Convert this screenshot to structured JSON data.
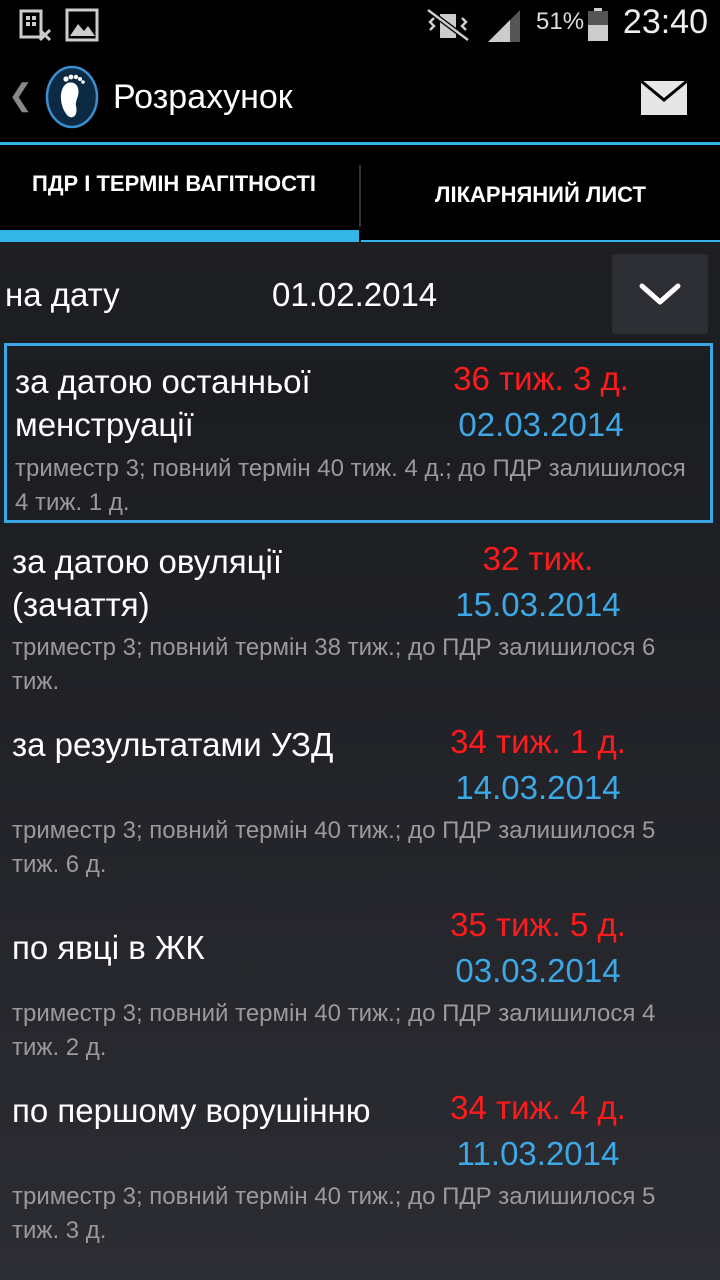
{
  "status_bar": {
    "battery": "51%",
    "time": "23:40"
  },
  "action_bar": {
    "title": "Розрахунок"
  },
  "tabs": [
    {
      "label": "ПДР І ТЕРМІН ВАГІТНОСТІ",
      "selected": true
    },
    {
      "label": "ЛІКАРНЯНИЙ ЛИСТ",
      "selected": false
    }
  ],
  "date_row": {
    "label": "на дату",
    "value": "01.02.2014"
  },
  "items": [
    {
      "title": "за датою останньої менструації",
      "weeks": "36 тиж. 3 д.",
      "date": "02.03.2014",
      "info": "триместр 3; повний термін 40 тиж. 4 д.; до ПДР залишилося 4 тиж. 1 д.",
      "selected": true
    },
    {
      "title": "за датою овуляції (зачаття)",
      "weeks": "32 тиж.",
      "date": "15.03.2014",
      "info": "триместр 3; повний термін 38 тиж.; до ПДР залишилося 6 тиж.",
      "selected": false
    },
    {
      "title": "за результатами УЗД",
      "weeks": "34 тиж. 1 д.",
      "date": "14.03.2014",
      "info": "триместр 3; повний термін 40 тиж.; до ПДР залишилося 5 тиж. 6 д.",
      "selected": false
    },
    {
      "title": "по явці в ЖК",
      "weeks": "35 тиж. 5 д.",
      "date": "03.03.2014",
      "info": "триместр 3; повний термін 40 тиж.; до ПДР залишилося 4 тиж. 2 д.",
      "selected": false
    },
    {
      "title": "по першому ворушінню",
      "weeks": "34 тиж. 4 д.",
      "date": "11.03.2014",
      "info": "триместр 3; повний термін 40 тиж.; до ПДР залишилося 5 тиж. 3 д.",
      "selected": false
    }
  ],
  "colors": {
    "accent": "#33b5e5",
    "weeks": "#ff1b1b",
    "date": "#3da8e6",
    "info": "#9a9a9a"
  }
}
